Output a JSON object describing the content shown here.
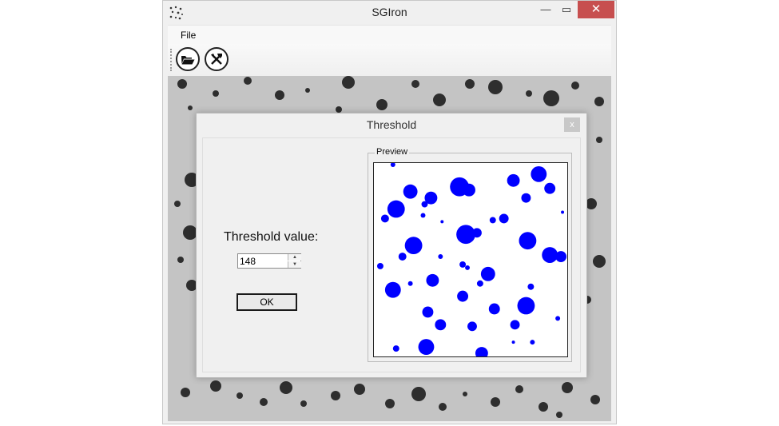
{
  "window": {
    "title": "SGIron",
    "minimize_glyph": "—",
    "maximize_glyph": "▭",
    "close_glyph": "✕"
  },
  "menu": {
    "file_label": "File"
  },
  "toolbar": {
    "buttons": [
      {
        "icon": "open-folder-icon"
      },
      {
        "icon": "tools-icon"
      }
    ]
  },
  "dialog": {
    "title": "Threshold",
    "close_glyph": "x",
    "threshold_label": "Threshold value:",
    "threshold_value": "148",
    "ok_label": "OK",
    "preview_label": "Preview"
  },
  "colors": {
    "blob": "#0000ff",
    "close_red": "#c74f4f"
  }
}
